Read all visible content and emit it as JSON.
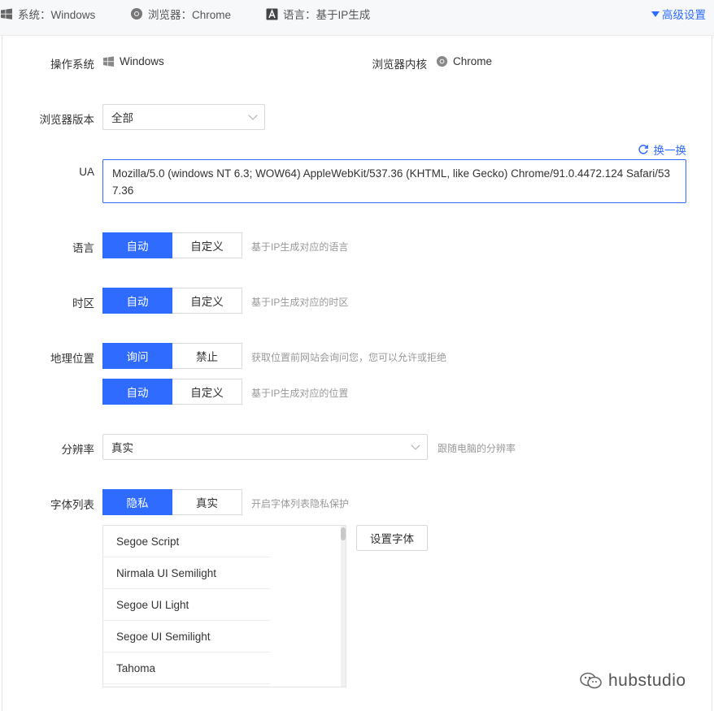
{
  "topbar": {
    "os_text": "系统：Windows",
    "browser_text": "浏览器：Chrome",
    "lang_text": "语言：基于IP生成",
    "advanced": "高级设置"
  },
  "os": {
    "label": "操作系统",
    "value": "Windows"
  },
  "kernel": {
    "label": "浏览器内核",
    "value": "Chrome"
  },
  "version": {
    "label": "浏览器版本",
    "value": "全部"
  },
  "ua": {
    "label": "UA",
    "swap": "换一换",
    "value": "Mozilla/5.0 (windows NT 6.3; WOW64) AppleWebKit/537.36 (KHTML, like Gecko) Chrome/91.0.4472.124 Safari/537.36"
  },
  "language": {
    "label": "语言",
    "opt1": "自动",
    "opt2": "自定义",
    "hint": "基于IP生成对应的语言"
  },
  "timezone": {
    "label": "时区",
    "opt1": "自动",
    "opt2": "自定义",
    "hint": "基于IP生成对应的时区"
  },
  "geo": {
    "label": "地理位置",
    "opt1": "询问",
    "opt2": "禁止",
    "hint": "获取位置前网站会询问您，您可以允许或拒绝",
    "opt3": "自动",
    "opt4": "自定义",
    "hint2": "基于IP生成对应的位置"
  },
  "resolution": {
    "label": "分辨率",
    "value": "真实",
    "hint": "跟随电脑的分辨率"
  },
  "fonts": {
    "label": "字体列表",
    "opt1": "隐私",
    "opt2": "真实",
    "hint": "开启字体列表隐私保护",
    "set_button": "设置字体",
    "items": [
      "Segoe Script",
      "Nirmala UI Semilight",
      "Segoe UI Light",
      "Segoe UI Semilight",
      "Tahoma"
    ]
  },
  "watermark": "hubstudio",
  "colors": {
    "accent": "#2f6bff"
  }
}
